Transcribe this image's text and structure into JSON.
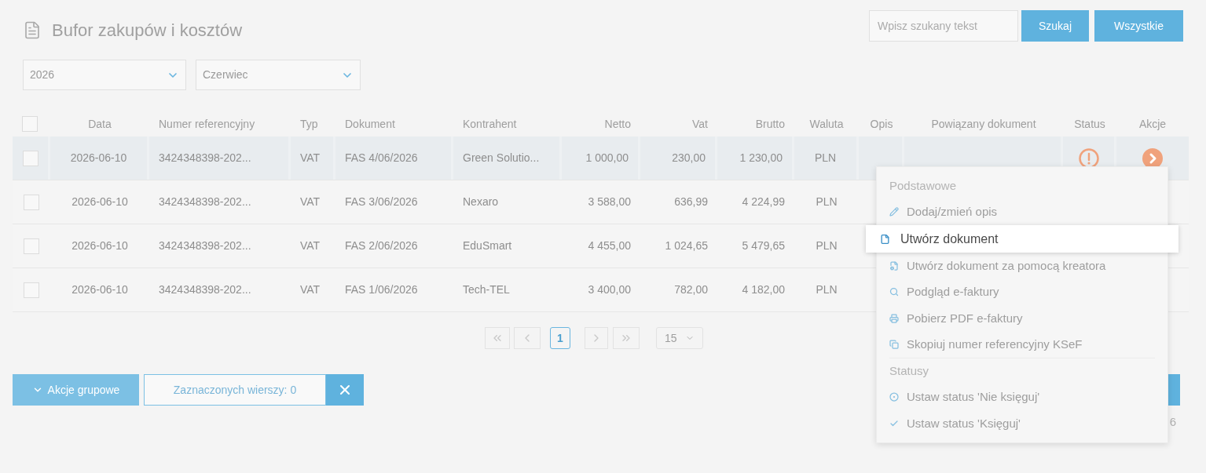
{
  "page": {
    "title": "Bufor zakupów i kosztów"
  },
  "search": {
    "placeholder": "Wpisz szukany tekst",
    "buttons": [
      "Szukaj",
      "Wszystkie"
    ]
  },
  "filters": {
    "year": "2026",
    "month": "Czerwiec"
  },
  "table": {
    "select_all": {
      "checked": false
    },
    "columns": [
      "Data",
      "Numer referencyjny",
      "Typ",
      "Dokument",
      "Kontrahent",
      "Netto",
      "Vat",
      "Brutto",
      "Waluta",
      "Opis",
      "Powiązany dokument",
      "Status",
      "Akcje"
    ],
    "rows": [
      {
        "selected": true,
        "checked": false,
        "date": "2026-06-10",
        "reference": "3424348398-202...",
        "type": "VAT",
        "document": "FAS 4/06/2026",
        "contractor": "Green Solutio...",
        "net": "1 000,00",
        "vat": "230,00",
        "gross": "1 230,00",
        "currency": "PLN"
      },
      {
        "selected": false,
        "checked": false,
        "date": "2026-06-10",
        "reference": "3424348398-202...",
        "type": "VAT",
        "document": "FAS 3/06/2026",
        "contractor": "Nexaro",
        "net": "3 588,00",
        "vat": "636,99",
        "gross": "4 224,99",
        "currency": "PLN"
      },
      {
        "selected": false,
        "checked": false,
        "date": "2026-06-10",
        "reference": "3424348398-202...",
        "type": "VAT",
        "document": "FAS 2/06/2026",
        "contractor": "EduSmart",
        "net": "4 455,00",
        "vat": "1 024,65",
        "gross": "5 479,65",
        "currency": "PLN"
      },
      {
        "selected": false,
        "checked": false,
        "date": "2026-06-10",
        "reference": "3424348398-202...",
        "type": "VAT",
        "document": "FAS 1/06/2026",
        "contractor": "Tech-TEL",
        "net": "3 400,00",
        "vat": "782,00",
        "gross": "4 182,00",
        "currency": "PLN"
      }
    ]
  },
  "pagination": {
    "pages": [
      {
        "label": "1",
        "selected": true
      }
    ],
    "page_size": "15"
  },
  "bulk_actions": {
    "button": "Akcje grupowe",
    "selected_rows": "Zaznaczonych wierszy: 0"
  },
  "footer_right": {
    "text_fragment": "6"
  },
  "context_menu": {
    "items": [
      {
        "kind": "header",
        "label": "Podstawowe"
      },
      {
        "kind": "item",
        "label": "Dodaj/zmień opis",
        "selected": false
      },
      {
        "kind": "item",
        "label": "Utwórz dokument",
        "selected": true
      },
      {
        "kind": "item",
        "label": "Utwórz dokument za pomocą kreatora",
        "selected": false
      },
      {
        "kind": "item",
        "label": "Podgląd e-faktury",
        "selected": false
      },
      {
        "kind": "item",
        "label": "Pobierz PDF e-faktury",
        "selected": false
      },
      {
        "kind": "item",
        "label": "Skopiuj numer referencyjny KSeF",
        "selected": false
      },
      {
        "kind": "header",
        "label": "Statusy"
      },
      {
        "kind": "item",
        "label": "Ustaw status 'Nie księguj'",
        "selected": false
      },
      {
        "kind": "item",
        "label": "Ustaw status 'Księguj'",
        "selected": false
      }
    ]
  }
}
